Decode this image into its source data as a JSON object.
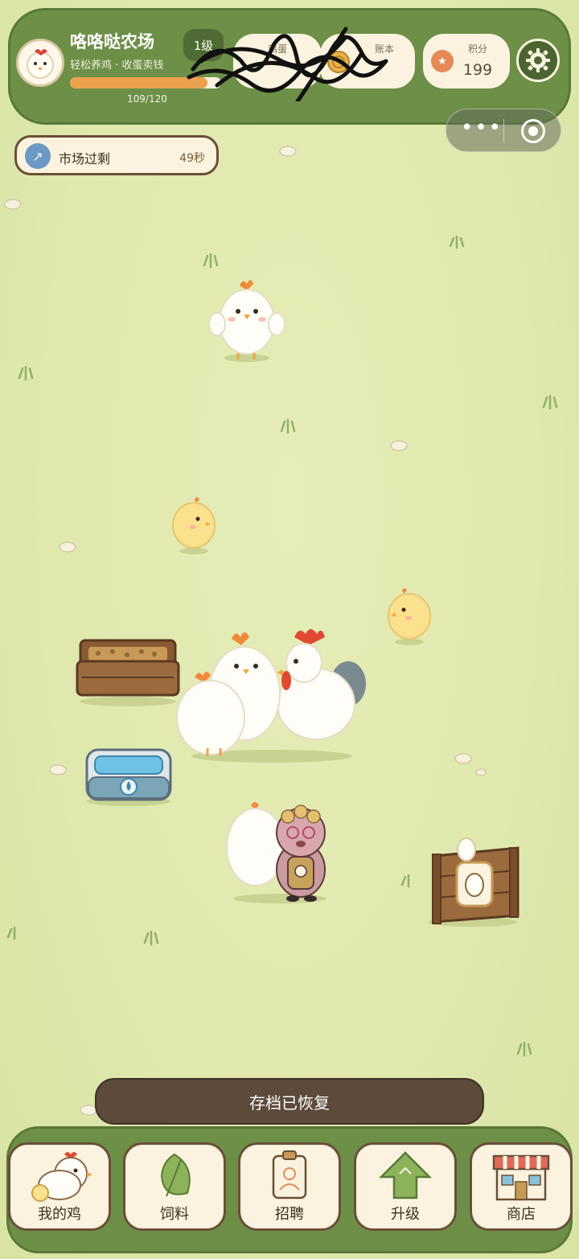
{
  "header": {
    "farm_name": "咯咯哒农场",
    "tagline": "轻松养鸡 · 收蛋卖钱",
    "level": "1级",
    "xp_text": "109/120",
    "xp_progress": 0.908,
    "eggs_label": "鸡蛋",
    "ledger_label": "账本",
    "score_label": "积分",
    "score_value": "199"
  },
  "market": {
    "label": "市场过剩",
    "time": "49秒"
  },
  "toast": "存档已恢复",
  "nav": [
    {
      "label": "我的鸡",
      "icon": "chicken-icon"
    },
    {
      "label": "饲料",
      "icon": "leaf-icon"
    },
    {
      "label": "招聘",
      "icon": "id-badge-icon"
    },
    {
      "label": "升级",
      "icon": "up-arrow-icon"
    },
    {
      "label": "商店",
      "icon": "shop-icon"
    }
  ],
  "colors": {
    "grass": "#dfe8ad",
    "panel_green": "#6d8f48",
    "cream": "#fbf3df",
    "wood": "#6b4f37",
    "xp_orange": "#eaa24d"
  }
}
